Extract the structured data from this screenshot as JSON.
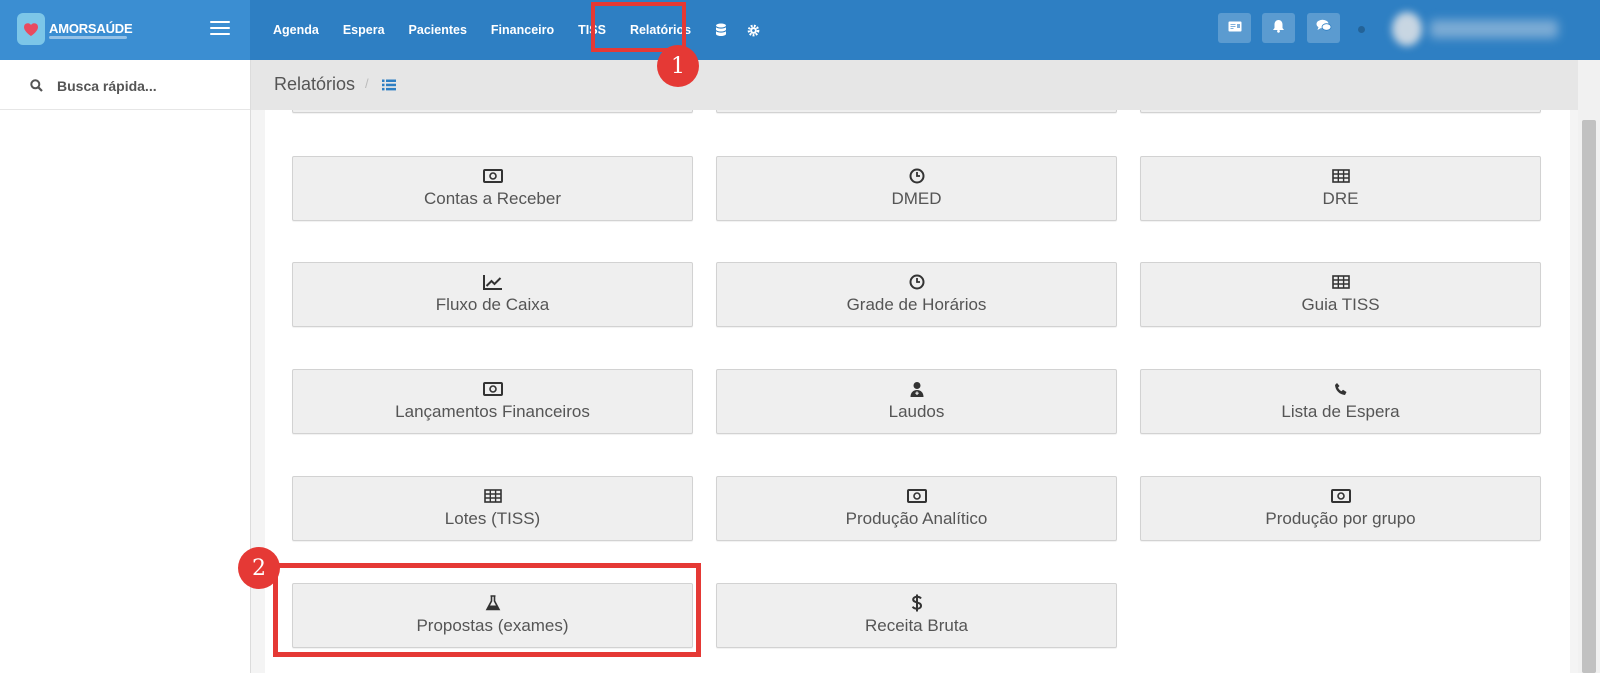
{
  "app": {
    "logo_text": "AMORSAÚDE"
  },
  "nav": {
    "items": [
      {
        "label": "Agenda"
      },
      {
        "label": "Espera"
      },
      {
        "label": "Pacientes"
      },
      {
        "label": "Financeiro"
      },
      {
        "label": "TISS"
      },
      {
        "label": "Relatórios",
        "active": true
      }
    ],
    "icons": [
      "database-icon",
      "gear-icon"
    ]
  },
  "header_right": {
    "buttons": [
      "id-card-icon",
      "bell-icon",
      "comments-icon"
    ]
  },
  "sidebar": {
    "search_label": "Busca rápida..."
  },
  "breadcrumb": {
    "title": "Relatórios",
    "separator": "/"
  },
  "reports": [
    {
      "label": "Contas a Receber",
      "icon": "money-icon"
    },
    {
      "label": "DMED",
      "icon": "clock-icon"
    },
    {
      "label": "DRE",
      "icon": "table-icon"
    },
    {
      "label": "Fluxo de Caixa",
      "icon": "line-chart-icon"
    },
    {
      "label": "Grade de Horários",
      "icon": "clock-icon"
    },
    {
      "label": "Guia TISS",
      "icon": "table-icon"
    },
    {
      "label": "Lançamentos Financeiros",
      "icon": "money-icon"
    },
    {
      "label": "Laudos",
      "icon": "user-md-icon"
    },
    {
      "label": "Lista de Espera",
      "icon": "phone-icon"
    },
    {
      "label": "Lotes (TISS)",
      "icon": "table-icon"
    },
    {
      "label": "Produção Analítico",
      "icon": "money-icon"
    },
    {
      "label": "Produção por grupo",
      "icon": "money-icon"
    },
    {
      "label": "Propostas (exames)",
      "icon": "flask-icon"
    },
    {
      "label": "Receita Bruta",
      "icon": "dollar-icon"
    }
  ],
  "annotations": [
    {
      "number": "1"
    },
    {
      "number": "2"
    }
  ],
  "colors": {
    "header_blue": "#2e7fc3",
    "logo_blue": "#3b8ed2",
    "annotation_red": "#e53935",
    "tile_bg": "#efefef"
  }
}
